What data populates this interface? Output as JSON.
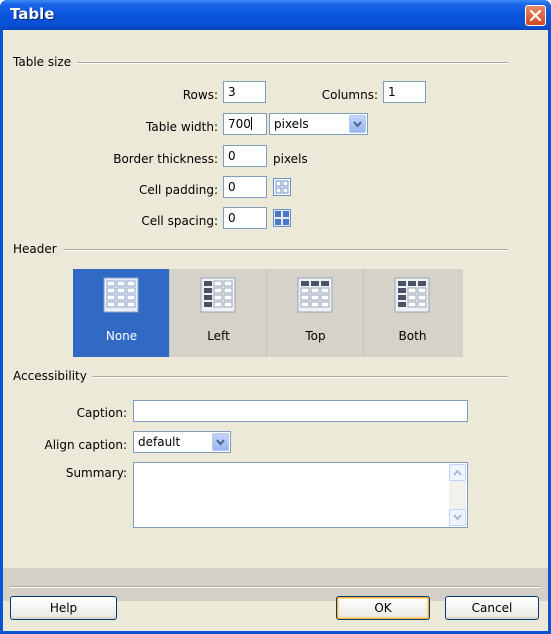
{
  "window": {
    "title": "Table"
  },
  "table_size": {
    "legend": "Table size",
    "rows_label": "Rows:",
    "rows_value": "3",
    "columns_label": "Columns:",
    "columns_value": "1",
    "width_label": "Table width:",
    "width_value": "700",
    "width_unit": "pixels",
    "border_label": "Border thickness:",
    "border_value": "0",
    "border_unit": "pixels",
    "padding_label": "Cell padding:",
    "padding_value": "0",
    "spacing_label": "Cell spacing:",
    "spacing_value": "0"
  },
  "header": {
    "legend": "Header",
    "options": [
      {
        "label": "None",
        "selected": true,
        "icon": "table-no-header-icon"
      },
      {
        "label": "Left",
        "selected": false,
        "icon": "table-left-header-icon"
      },
      {
        "label": "Top",
        "selected": false,
        "icon": "table-top-header-icon"
      },
      {
        "label": "Both",
        "selected": false,
        "icon": "table-both-header-icon"
      }
    ]
  },
  "accessibility": {
    "legend": "Accessibility",
    "caption_label": "Caption:",
    "caption_value": "",
    "align_label": "Align caption:",
    "align_value": "default",
    "summary_label": "Summary:",
    "summary_value": ""
  },
  "buttons": {
    "help": "Help",
    "ok": "OK",
    "cancel": "Cancel"
  },
  "colors": {
    "selected": "#316ac5",
    "titlebar": "#0855dd",
    "dialog_bg": "#ece9d8"
  }
}
